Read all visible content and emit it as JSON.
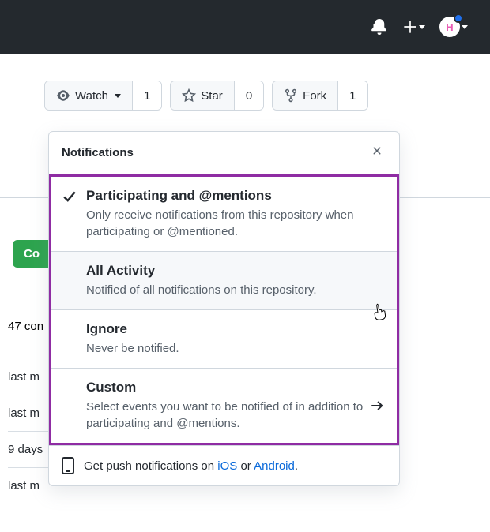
{
  "header": {
    "avatar_letter": "H"
  },
  "actions": {
    "watch": {
      "label": "Watch",
      "count": "1"
    },
    "star": {
      "label": "Star",
      "count": "0"
    },
    "fork": {
      "label": "Fork",
      "count": "1"
    }
  },
  "partial": {
    "code_btn": "Co",
    "commits": "47 con",
    "rows": [
      "last m",
      "last m",
      "9 days",
      "last m"
    ]
  },
  "popup": {
    "title": "Notifications",
    "options": [
      {
        "title": "Participating and @mentions",
        "desc": "Only receive notifications from this repository when participating or @mentioned."
      },
      {
        "title": "All Activity",
        "desc": "Notified of all notifications on this repository."
      },
      {
        "title": "Ignore",
        "desc": "Never be notified."
      },
      {
        "title": "Custom",
        "desc": "Select events you want to be notified of in addition to participating and @mentions."
      }
    ],
    "footer_pre": "Get push notifications on ",
    "footer_ios": "iOS",
    "footer_or": " or ",
    "footer_android": "Android",
    "footer_dot": "."
  }
}
